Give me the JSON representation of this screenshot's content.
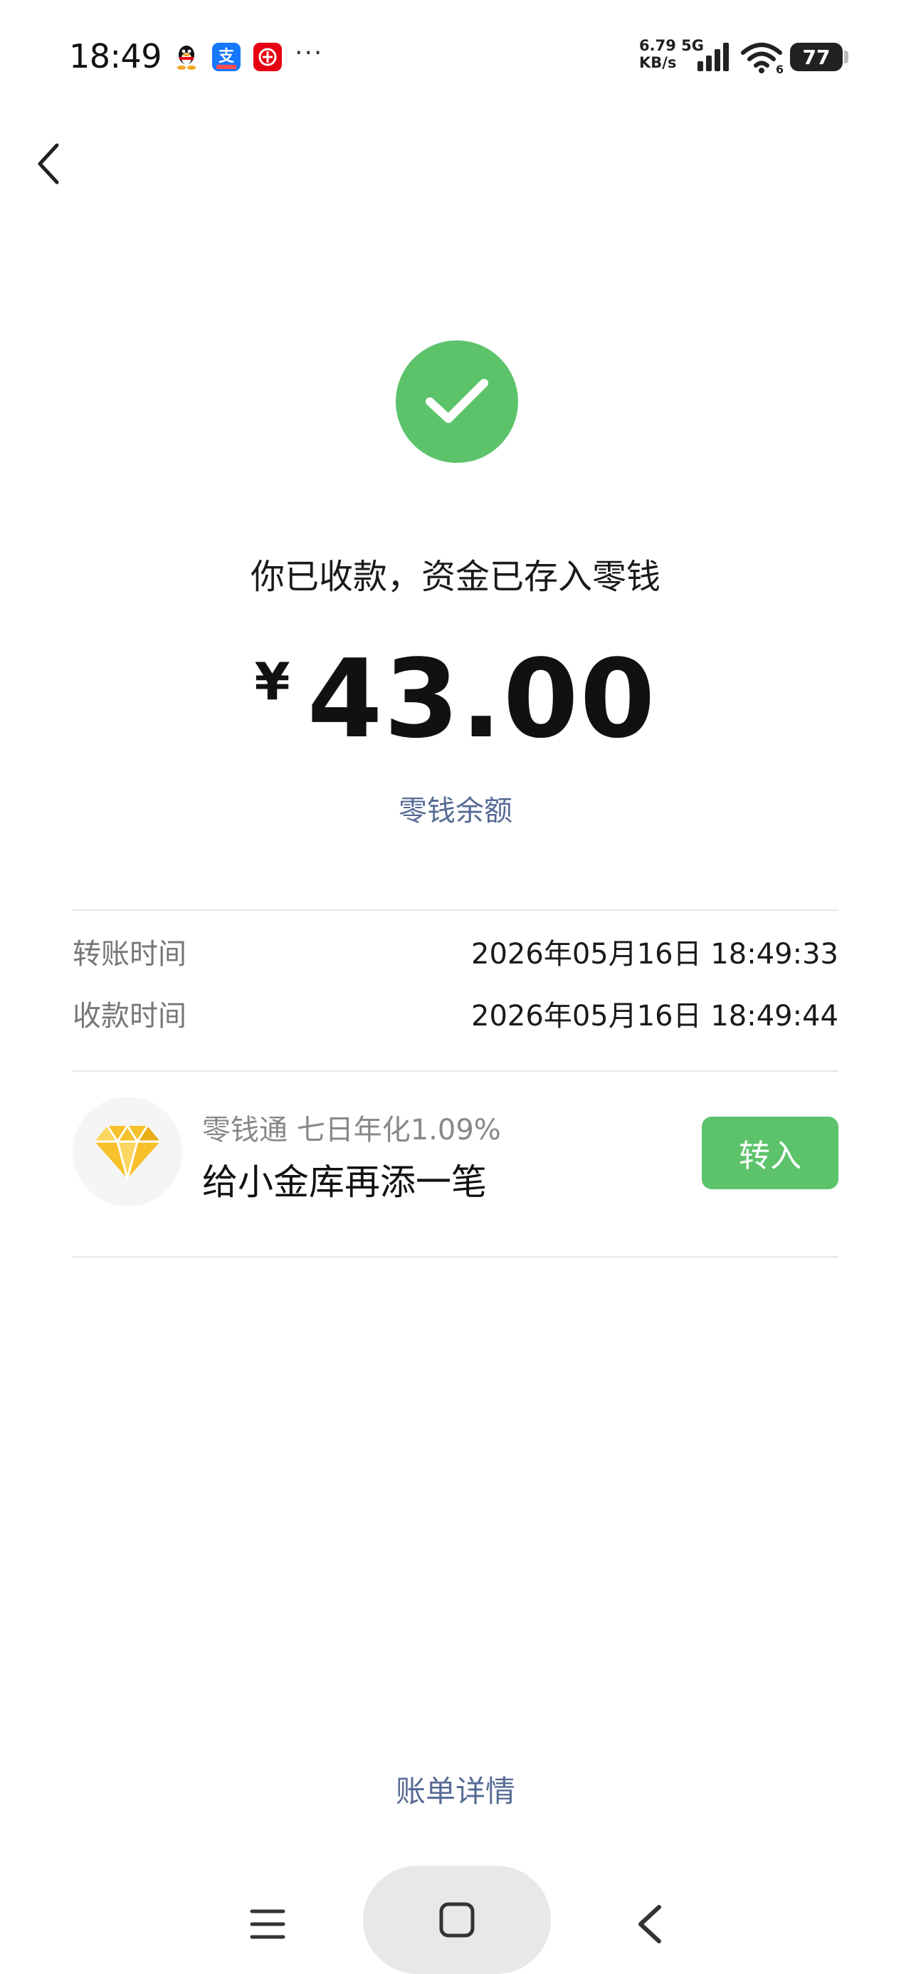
{
  "status_bar": {
    "time": "18:49",
    "net_speed_value": "6.79",
    "net_speed_type": "5G",
    "net_speed_unit": "KB/s",
    "wifi_label": "6",
    "battery": "77",
    "more_dots": "···",
    "notification_icons": [
      "qq-icon",
      "alipay-icon",
      "bank-icon"
    ]
  },
  "nav": {
    "back_icon": "chevron-left-icon"
  },
  "receipt": {
    "status_icon": "checkmark-circle-icon",
    "message": "你已收款，资金已存入零钱",
    "currency": "¥",
    "amount": "43.00",
    "balance_link": "零钱余额"
  },
  "details": [
    {
      "label": "转账时间",
      "value": "2026年05月16日 18:49:33"
    },
    {
      "label": "收款时间",
      "value": "2026年05月16日 18:49:44"
    }
  ],
  "promo": {
    "icon": "diamond-icon",
    "subtitle": "零钱通 七日年化1.09%",
    "title": "给小金库再添一笔",
    "button": "转入"
  },
  "footer": {
    "bill_link": "账单详情"
  },
  "system_nav": {
    "items": [
      "menu-icon",
      "home-icon",
      "back-icon"
    ]
  },
  "colors": {
    "accent_green": "#5cc36b",
    "link_blue": "#576b95",
    "diamond_yellow": "#f7c12b"
  }
}
